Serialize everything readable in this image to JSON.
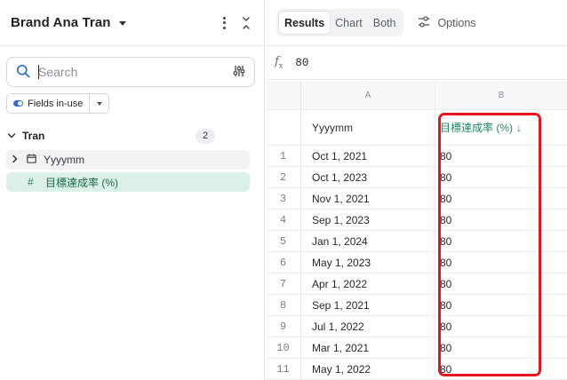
{
  "sidebar": {
    "title": "Brand Ana Tran",
    "search": {
      "placeholder": "Search",
      "value": ""
    },
    "fields_filter": {
      "label": "Fields in-use"
    },
    "group": {
      "name": "Tran",
      "count": "2"
    },
    "fields": [
      {
        "label": "Yyyymm",
        "type_icon": "calendar-icon"
      },
      {
        "label": "目標達成率 (%)",
        "type_icon": "hash-icon",
        "type_glyph": "#"
      }
    ]
  },
  "view": {
    "tabs": [
      {
        "label": "Results",
        "active": true
      },
      {
        "label": "Chart",
        "active": false
      },
      {
        "label": "Both",
        "active": false
      }
    ],
    "options_label": "Options",
    "formula": {
      "fx_glyph": "f",
      "fx_sub": "x",
      "value": "80"
    }
  },
  "table": {
    "column_letters": [
      "A",
      "B"
    ],
    "headers": [
      "Yyyymm",
      "目標達成率 (%)"
    ],
    "sort_indicator": "↓",
    "rows": [
      {
        "n": "1",
        "a": "Oct 1, 2021",
        "b": "80"
      },
      {
        "n": "2",
        "a": "Oct 1, 2023",
        "b": "80"
      },
      {
        "n": "3",
        "a": "Nov 1, 2021",
        "b": "80"
      },
      {
        "n": "4",
        "a": "Sep 1, 2023",
        "b": "80"
      },
      {
        "n": "5",
        "a": "Jan 1, 2024",
        "b": "80"
      },
      {
        "n": "6",
        "a": "May 1, 2023",
        "b": "80"
      },
      {
        "n": "7",
        "a": "Apr 1, 2022",
        "b": "80"
      },
      {
        "n": "8",
        "a": "Sep 1, 2021",
        "b": "80"
      },
      {
        "n": "9",
        "a": "Jul 1, 2022",
        "b": "80"
      },
      {
        "n": "10",
        "a": "Mar 1, 2021",
        "b": "80"
      },
      {
        "n": "11",
        "a": "May 1, 2022",
        "b": "80"
      }
    ]
  },
  "colors": {
    "accent_green": "#1e8a60",
    "highlight_red": "#e8141c",
    "toggle_blue": "#2f6cd4",
    "selected_field_bg": "#dbf0e6"
  }
}
